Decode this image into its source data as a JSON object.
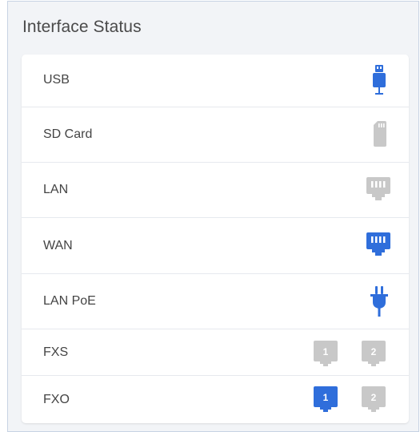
{
  "panel": {
    "title": "Interface Status"
  },
  "colors": {
    "active": "#2f6edb",
    "inactive": "#c8c8c8"
  },
  "interfaces": [
    {
      "label": "USB",
      "icon": "usb-icon",
      "status": "active"
    },
    {
      "label": "SD Card",
      "icon": "sd-card-icon",
      "status": "inactive"
    },
    {
      "label": "LAN",
      "icon": "ethernet-port-icon",
      "status": "inactive"
    },
    {
      "label": "WAN",
      "icon": "ethernet-port-icon",
      "status": "active"
    },
    {
      "label": "LAN PoE",
      "icon": "power-plug-icon",
      "status": "active"
    },
    {
      "label": "FXS",
      "icon": "phone-port-icon",
      "ports": [
        {
          "number": "1",
          "status": "inactive"
        },
        {
          "number": "2",
          "status": "inactive"
        }
      ]
    },
    {
      "label": "FXO",
      "icon": "phone-port-icon",
      "ports": [
        {
          "number": "1",
          "status": "active"
        },
        {
          "number": "2",
          "status": "inactive"
        }
      ]
    }
  ]
}
